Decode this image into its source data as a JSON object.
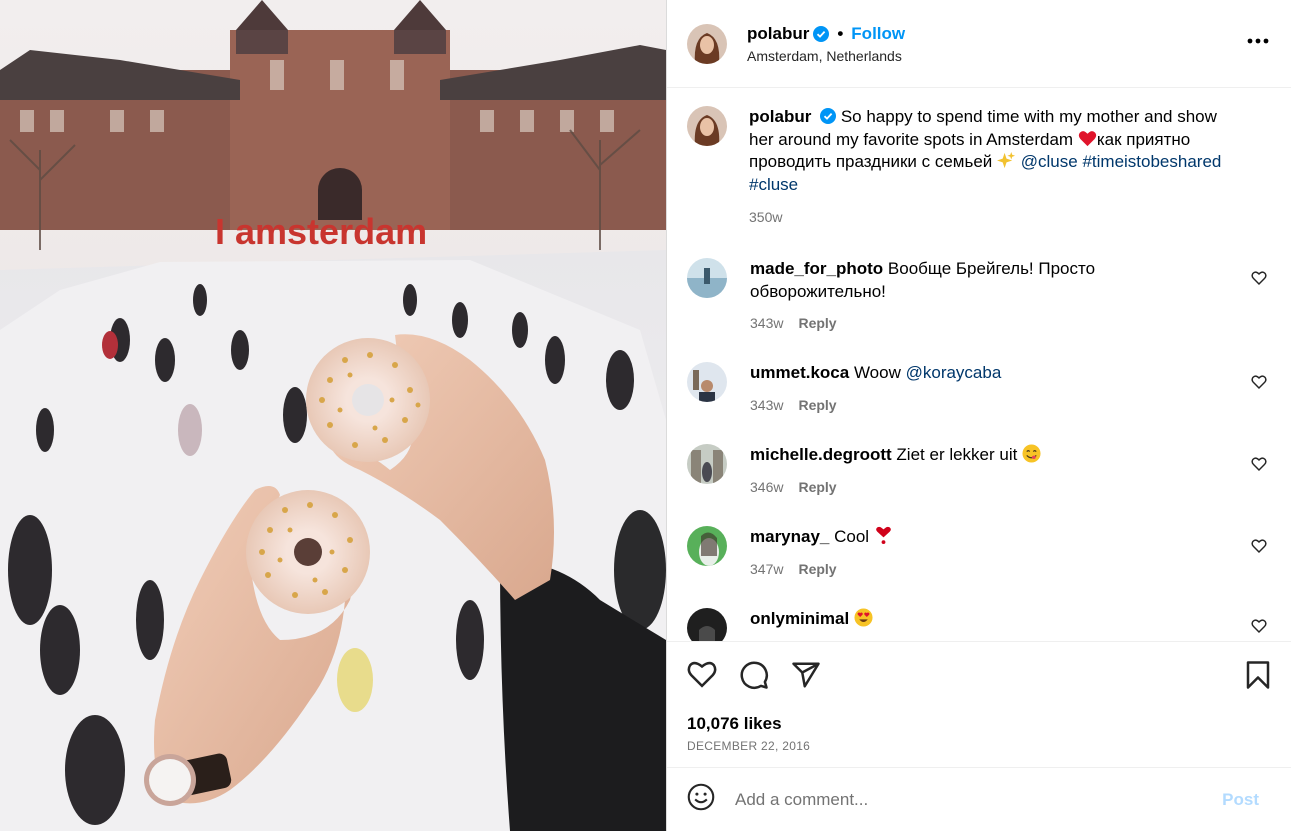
{
  "post": {
    "username": "polabur",
    "follow_label": "Follow",
    "dot": "•",
    "location": "Amsterdam, Netherlands",
    "more_label": "•••"
  },
  "caption": {
    "username": "polabur",
    "text_1": "So happy to spend time with my mother and show her around my favorite spots in Amsterdam",
    "text_2": "как приятно проводить праздники с семьей",
    "mention": "@cluse",
    "hashtag_1": "#timeistobeshared",
    "hashtag_2": "#cluse",
    "time": "350w"
  },
  "comments": [
    {
      "username": "made_for_photo",
      "text": "Вообще Брейгель! Просто обворожительно!",
      "time": "343w",
      "reply": "Reply"
    },
    {
      "username": "ummet.koca",
      "text": "Woow",
      "mention": "@koraycaba",
      "time": "343w",
      "reply": "Reply"
    },
    {
      "username": "michelle.degroott",
      "text": "Ziet er lekker uit",
      "time": "346w",
      "reply": "Reply"
    },
    {
      "username": "marynay_",
      "text": "Cool",
      "time": "347w",
      "reply": "Reply"
    },
    {
      "username": "onlyminimal",
      "text": ""
    }
  ],
  "actions": {
    "likes": "10,076 likes",
    "date": "DECEMBER 22, 2016"
  },
  "add_comment": {
    "placeholder": "Add a comment...",
    "post_label": "Post"
  },
  "photo_sign": "I amsterdam",
  "colors": {
    "accent": "#0095f6",
    "link": "#00376b",
    "verified": "#0095f6",
    "heart_emoji": "#e0142b"
  }
}
